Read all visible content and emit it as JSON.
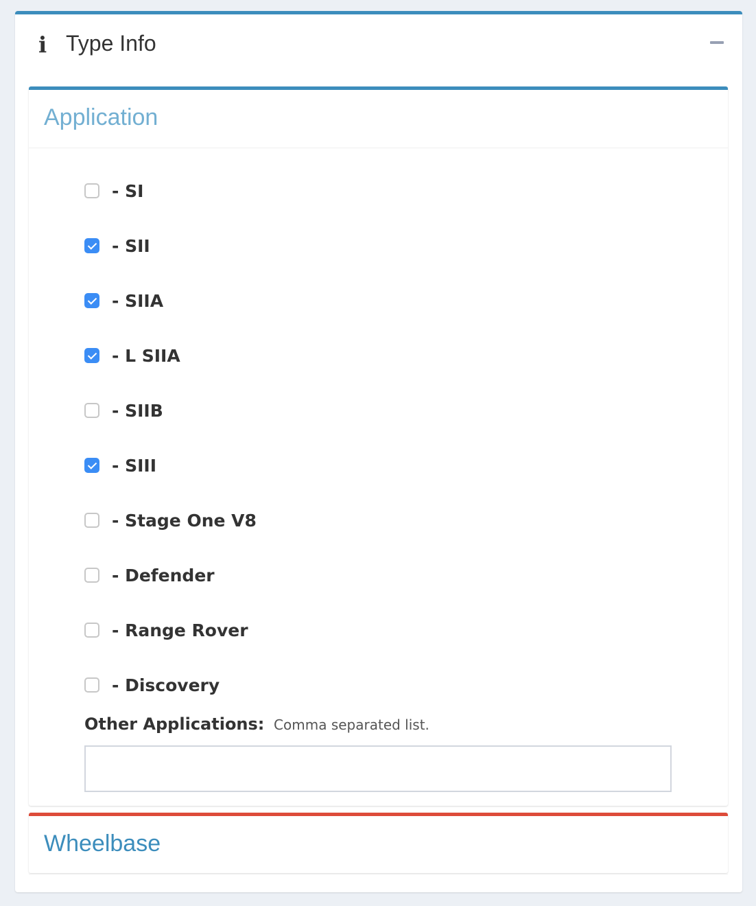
{
  "box": {
    "title": "Type Info",
    "info_icon": "i",
    "collapse_icon": "minus-icon"
  },
  "application": {
    "title": "Application",
    "items": [
      {
        "label": "- SI",
        "checked": false
      },
      {
        "label": "- SII",
        "checked": true
      },
      {
        "label": "- SIIA",
        "checked": true
      },
      {
        "label": "- L SIIA",
        "checked": true
      },
      {
        "label": "- SIIB",
        "checked": false
      },
      {
        "label": "- SIII",
        "checked": true
      },
      {
        "label": "- Stage One V8",
        "checked": false
      },
      {
        "label": "- Defender",
        "checked": false
      },
      {
        "label": "- Range Rover",
        "checked": false
      },
      {
        "label": "- Discovery",
        "checked": false
      }
    ],
    "other_label": "Other Applications:",
    "other_hint": "Comma separated list.",
    "other_value": ""
  },
  "wheelbase": {
    "title": "Wheelbase"
  },
  "colors": {
    "primary": "#3c8dbc",
    "danger": "#dd4b39",
    "checkbox_checked": "#3b8df5",
    "application_title": "#72afd2"
  }
}
